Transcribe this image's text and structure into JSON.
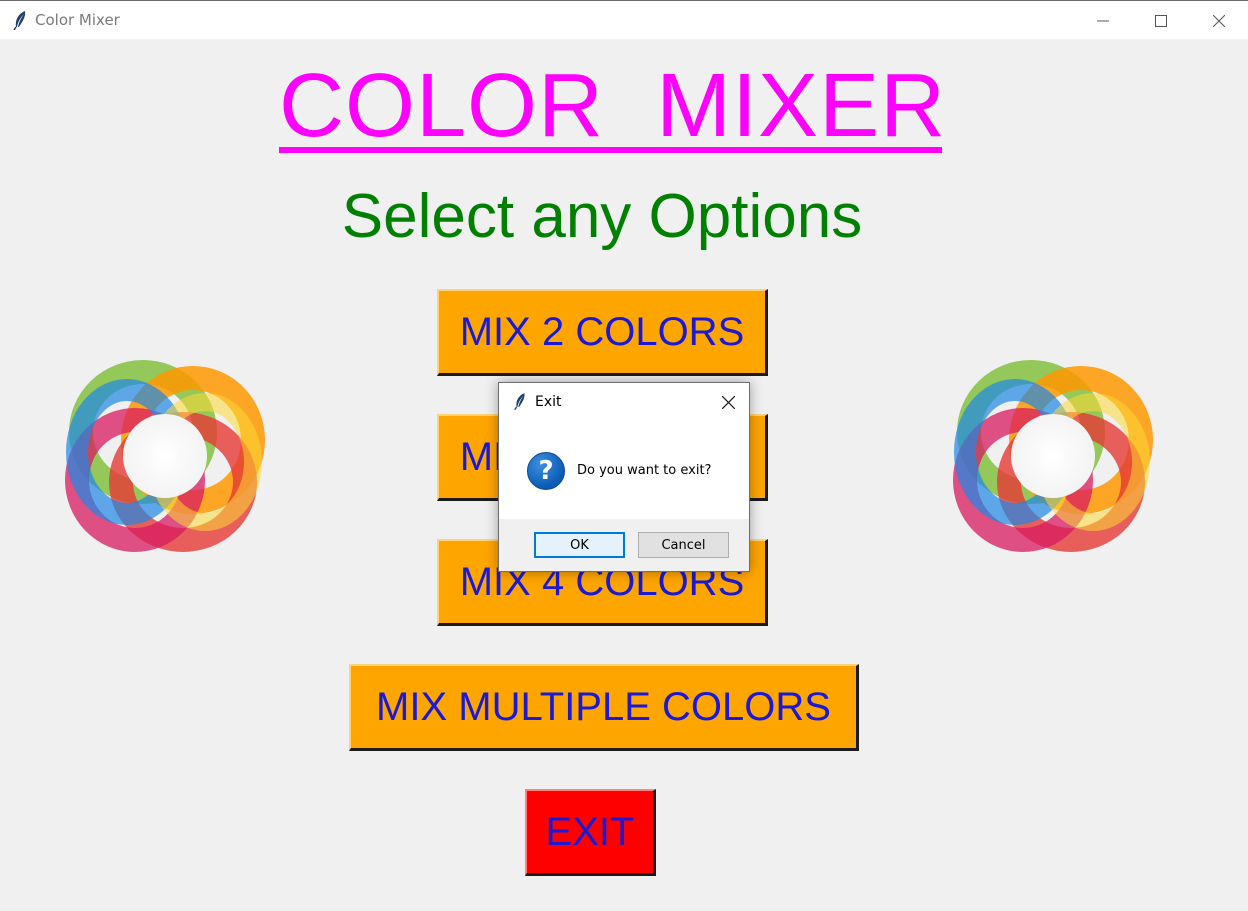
{
  "window": {
    "title": "Color Mixer",
    "icon": "feather-icon",
    "controls": [
      "minimize-icon",
      "maximize-icon",
      "close-icon"
    ]
  },
  "main": {
    "title": "COLOR  MIXER",
    "subtitle": "Select any Options",
    "title_color": "#ff00ff",
    "subtitle_color": "#008000",
    "buttons": [
      {
        "label": "MIX 2 COLORS",
        "bg": "#ffa500",
        "fg": "#1a1ad6"
      },
      {
        "label": "MIX 3 COLORS",
        "bg": "#ffa500",
        "fg": "#1a1ad6"
      },
      {
        "label": "MIX 4 COLORS",
        "bg": "#ffa500",
        "fg": "#1a1ad6"
      },
      {
        "label": "MIX MULTIPLE COLORS",
        "bg": "#ffa500",
        "fg": "#1a1ad6"
      },
      {
        "label": "EXIT",
        "bg": "#ff0000",
        "fg": "#1a1ad6"
      }
    ],
    "logo": "color-ring-logo"
  },
  "dialog": {
    "title": "Exit",
    "icon": "question-icon",
    "message": "Do you want to exit?",
    "ok_label": "OK",
    "cancel_label": "Cancel"
  }
}
